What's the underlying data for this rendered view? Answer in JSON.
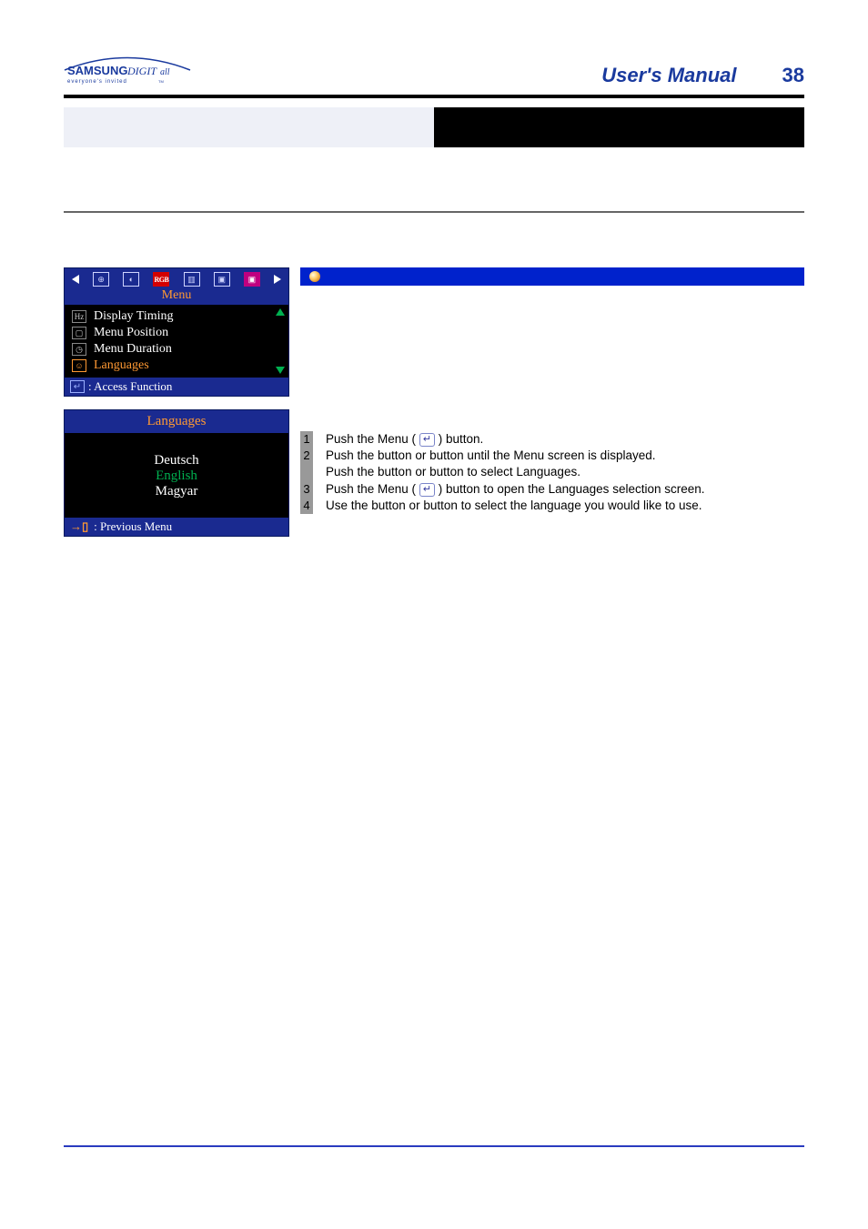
{
  "header": {
    "logo_top": "SAMSUNG DIGITall",
    "logo_sub": "everyone's invited",
    "title": "User's Manual",
    "page_number": "38"
  },
  "osd1": {
    "menu_label": "Menu",
    "icons": {
      "rgb": "RGB"
    },
    "items": [
      {
        "label": "Display Timing",
        "icon": "Hz",
        "selected": false
      },
      {
        "label": "Menu Position",
        "icon": "▢",
        "selected": false
      },
      {
        "label": "Menu Duration",
        "icon": "◷",
        "selected": false
      },
      {
        "label": "Languages",
        "icon": "☺",
        "selected": true
      }
    ],
    "footer_icon": "↵",
    "footer_label": ": Access Function"
  },
  "osd2": {
    "title": "Languages",
    "options": [
      {
        "label": "Deutsch",
        "selected": false
      },
      {
        "label": "English",
        "selected": true
      },
      {
        "label": "Magyar",
        "selected": false
      }
    ],
    "footer_icon": "→▯",
    "footer_label": ": Previous Menu"
  },
  "steps": [
    {
      "n": "1",
      "lines": [
        "Push the Menu ( ↵ ) button."
      ]
    },
    {
      "n": "2",
      "lines": [
        "Push the     button or     button until the Menu screen is displayed.",
        "Push the     button or     button to select Languages."
      ]
    },
    {
      "n": "3",
      "lines": [
        "Push the Menu ( ↵ ) button to open the Languages selection screen."
      ]
    },
    {
      "n": "4",
      "lines": [
        "Use the    button or    button to select the language you would like to use."
      ]
    }
  ]
}
